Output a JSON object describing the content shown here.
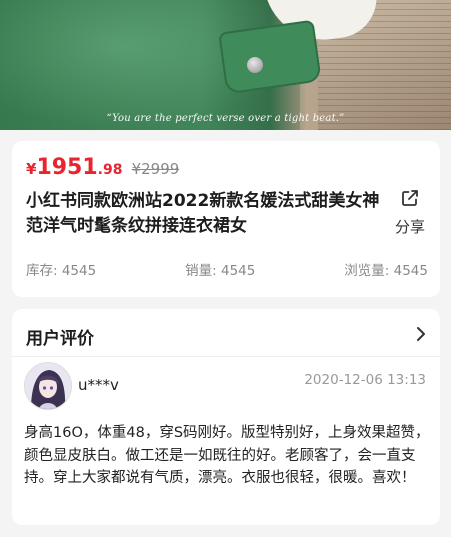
{
  "hero": {
    "caption": "“You are the perfect verse over a tight beat.”"
  },
  "product": {
    "currency": "¥",
    "price_int": "1951",
    "price_dec": ".98",
    "original_price": "¥2999",
    "title": "小红书同款欧洲站2022新款名媛法式甜美女神范洋气时髦条纹拼接连衣裙女",
    "share_label": "分享",
    "stats": [
      {
        "label": "库存: 4545"
      },
      {
        "label": "销量: 4545"
      },
      {
        "label": "浏览量: 4545"
      }
    ]
  },
  "reviews": {
    "header": "用户评价",
    "items": [
      {
        "username": "u***v",
        "date": "2020-12-06 13:13",
        "text": "身高16O，体重48，穿S码刚好。版型特别好，上身效果超赞，颜色显皮肤白。做工还是一如既往的好。老顾客了，会一直支持。穿上大家都说有气质，漂亮。衣服也很轻，很暖。喜欢！"
      }
    ]
  },
  "colors": {
    "price_red": "#e8242f",
    "page_background": "#f4f4f4"
  },
  "icons": {
    "share": "share-icon",
    "chevron": "chevron-right-icon"
  }
}
